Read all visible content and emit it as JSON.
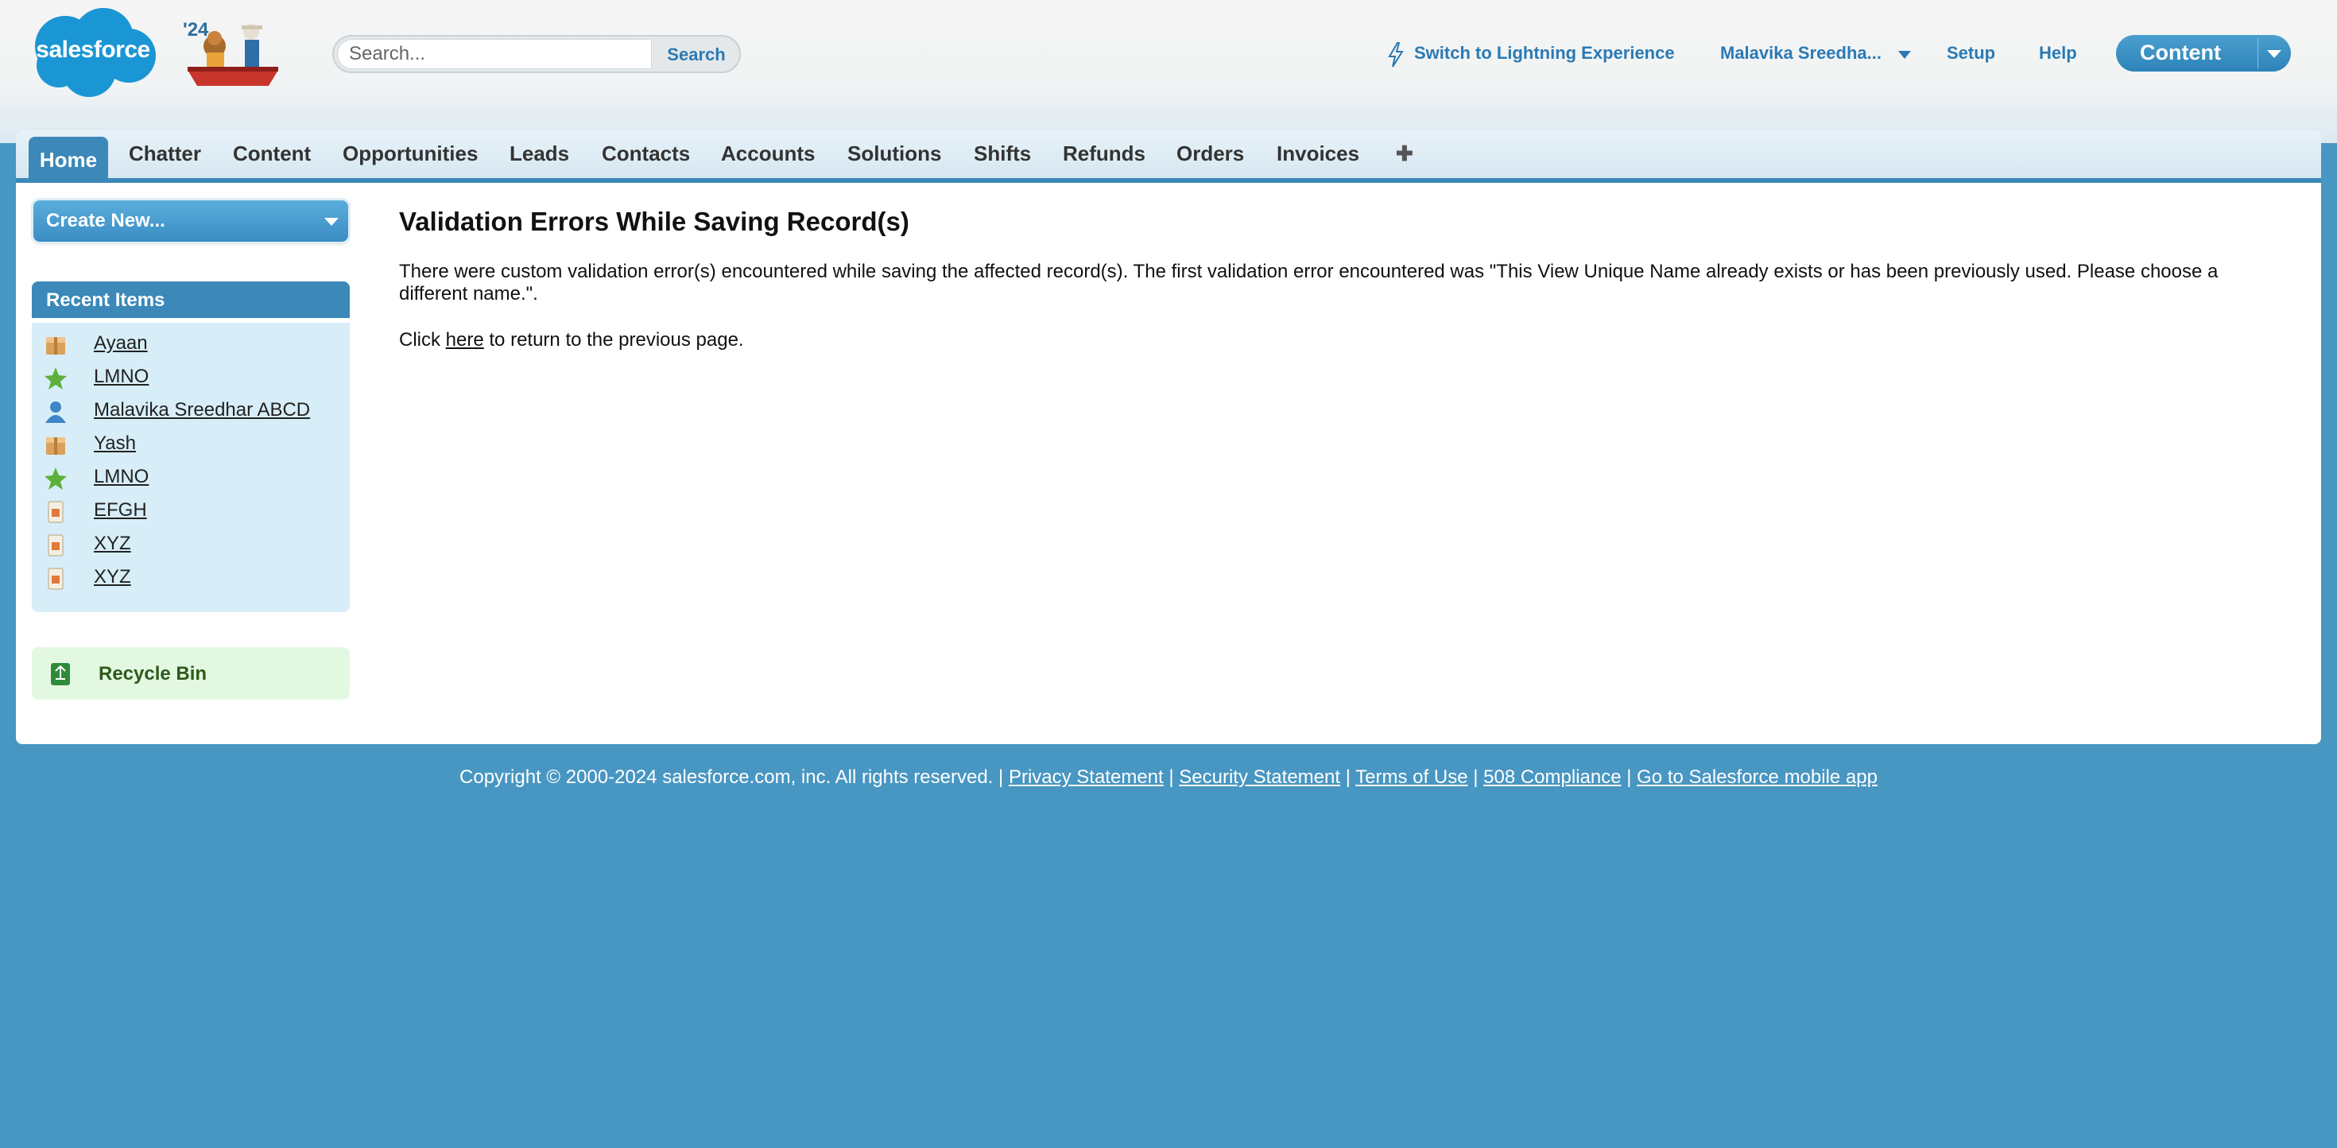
{
  "header": {
    "logo_text": "salesforce",
    "release_badge": "'24",
    "search": {
      "placeholder": "Search...",
      "value": "",
      "button_label": "Search"
    },
    "lightning_link": "Switch to Lightning Experience",
    "user_menu": "Malavika Sreedha...",
    "setup_link": "Setup",
    "help_link": "Help",
    "app_switcher": "Content"
  },
  "tabs": [
    {
      "label": "Home",
      "active": true
    },
    {
      "label": "Chatter"
    },
    {
      "label": "Content"
    },
    {
      "label": "Opportunities"
    },
    {
      "label": "Leads"
    },
    {
      "label": "Contacts"
    },
    {
      "label": "Accounts"
    },
    {
      "label": "Solutions"
    },
    {
      "label": "Shifts"
    },
    {
      "label": "Refunds"
    },
    {
      "label": "Orders"
    },
    {
      "label": "Invoices"
    },
    {
      "label": "✚"
    }
  ],
  "sidebar": {
    "create_new_label": "Create New...",
    "recent_items_title": "Recent Items",
    "recent_items": [
      {
        "label": "Ayaan",
        "icon": "box-icon"
      },
      {
        "label": "LMNO",
        "icon": "star-icon"
      },
      {
        "label": "Malavika Sreedhar ABCD",
        "icon": "user-icon"
      },
      {
        "label": "Yash",
        "icon": "box-icon"
      },
      {
        "label": "LMNO",
        "icon": "star-icon"
      },
      {
        "label": "EFGH",
        "icon": "document-icon"
      },
      {
        "label": "XYZ",
        "icon": "document-icon"
      },
      {
        "label": "XYZ",
        "icon": "document-icon"
      }
    ],
    "recycle_bin_label": "Recycle Bin"
  },
  "main": {
    "title": "Validation Errors While Saving Record(s)",
    "message": "There were custom validation error(s) encountered while saving the affected record(s). The first validation error encountered was \"This View Unique Name already exists or has been previously used. Please choose a different name.\".",
    "return_prefix": "Click",
    "return_link": "here",
    "return_suffix": "to return to the previous page."
  },
  "footer": {
    "copyright": "Copyright © 2000-2024 salesforce.com, inc. All rights reserved.",
    "separator": "|",
    "links": [
      "Privacy Statement",
      "Security Statement",
      "Terms of Use",
      "508 Compliance",
      "Go to Salesforce mobile app"
    ]
  },
  "colors": {
    "brand_blue": "#3b88b9",
    "page_bg": "#4896c2",
    "link_blue": "#2a7ab4",
    "recent_bg": "#d7eef8",
    "recycle_bg": "#e3f8e0"
  }
}
